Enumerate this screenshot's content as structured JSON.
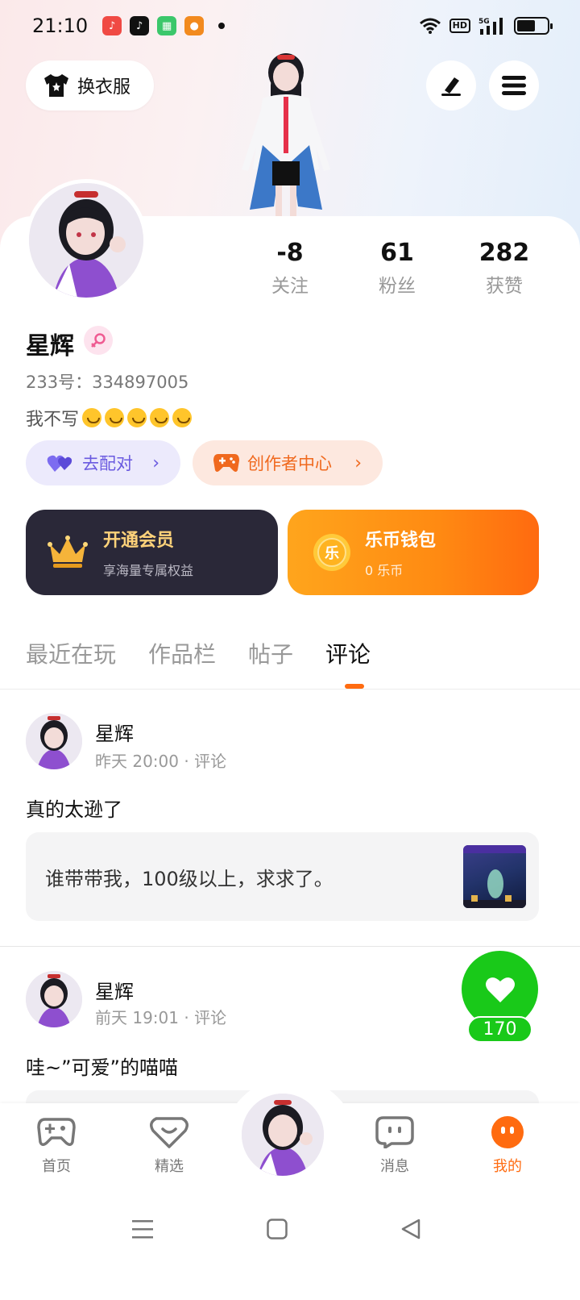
{
  "status_bar": {
    "time": "21:10",
    "hd": "HD",
    "net": "5G",
    "battery_pct": 0.6
  },
  "header": {
    "change_clothes": "换衣服"
  },
  "profile": {
    "stats": [
      {
        "value": "-8",
        "label": "关注"
      },
      {
        "value": "61",
        "label": "粉丝"
      },
      {
        "value": "282",
        "label": "获赞"
      }
    ],
    "name": "星辉",
    "uid": "233号：334897005",
    "bio": "我不写",
    "match_label": "去配对",
    "creator_label": "创作者中心"
  },
  "cards": {
    "vip": {
      "title": "开通会员",
      "subtitle": "享海量专属权益"
    },
    "wallet": {
      "title": "乐币钱包",
      "subtitle": "0 乐币",
      "coin_char": "乐"
    }
  },
  "tabs": [
    "最近在玩",
    "作品栏",
    "帖子",
    "评论"
  ],
  "posts": [
    {
      "name": "星辉",
      "meta": "昨天 20:00 · 评论",
      "text": "真的太逊了",
      "quote": "谁带带我，100级以上，求求了。"
    },
    {
      "name": "星辉",
      "meta": "前天 19:01 · 评论",
      "text": "哇~”可爱”的喵喵",
      "quote": ""
    }
  ],
  "like": {
    "count": "170"
  },
  "bottom_nav": [
    {
      "label": "首页"
    },
    {
      "label": "精选"
    },
    {
      "label": "消息"
    },
    {
      "label": "我的"
    }
  ],
  "colors": {
    "accent": "#ff6b10",
    "like_green": "#19c919",
    "match_purple": "#6a5ae0"
  }
}
